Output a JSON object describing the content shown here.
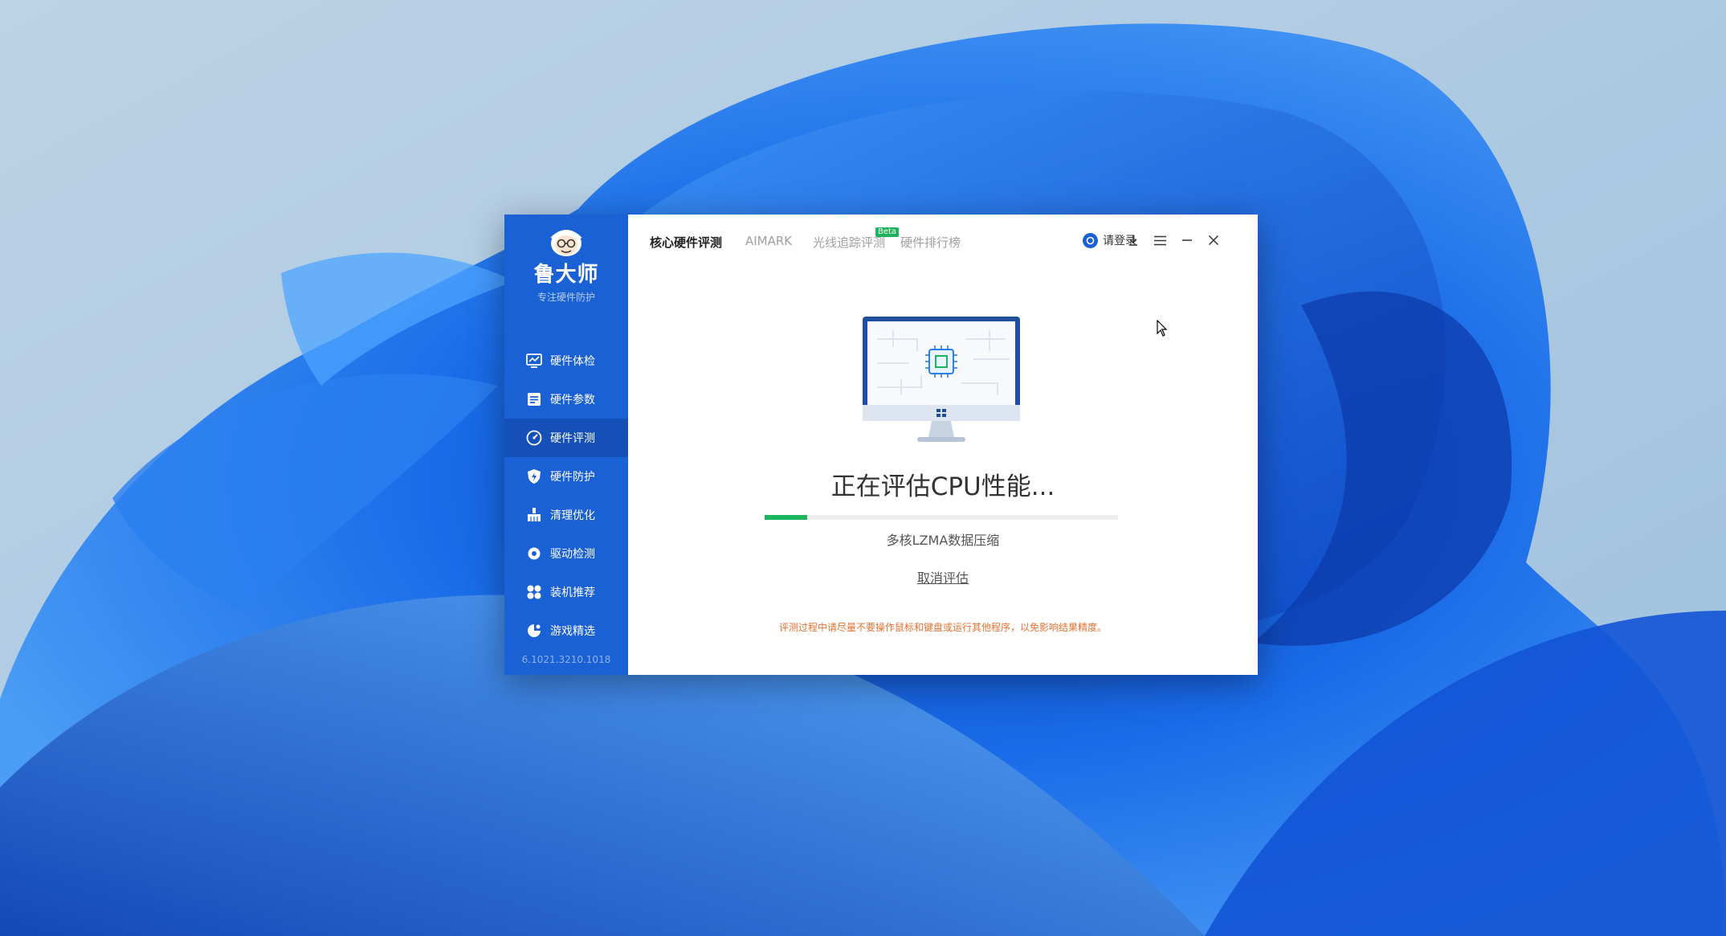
{
  "sidebar": {
    "brand_name": "鲁大师",
    "brand_slogan": "专注硬件防护",
    "items": [
      {
        "label": "硬件体检",
        "icon": "monitor-chart-icon",
        "active": false
      },
      {
        "label": "硬件参数",
        "icon": "list-icon",
        "active": false
      },
      {
        "label": "硬件评测",
        "icon": "speedometer-icon",
        "active": true
      },
      {
        "label": "硬件防护",
        "icon": "shield-bolt-icon",
        "active": false
      },
      {
        "label": "清理优化",
        "icon": "broom-icon",
        "active": false
      },
      {
        "label": "驱动检测",
        "icon": "gear-icon",
        "active": false
      },
      {
        "label": "装机推荐",
        "icon": "grid-icon",
        "active": false
      },
      {
        "label": "游戏精选",
        "icon": "gamepad-icon",
        "active": false
      }
    ],
    "version": "6.1021.3210.1018"
  },
  "header": {
    "tabs": [
      {
        "label": "核心硬件评测",
        "active": true
      },
      {
        "label": "AIMARK",
        "active": false
      },
      {
        "label": "光线追踪评测",
        "active": false
      },
      {
        "label": "硬件排行榜",
        "active": false
      }
    ],
    "beta_badge": "Beta",
    "login_label": "请登录"
  },
  "content": {
    "status_title": "正在评估CPU性能...",
    "progress_fraction": 0.12,
    "progress_step": "多核LZMA数据压缩",
    "cancel_label": "取消评估",
    "warning": "评测过程中请尽量不要操作鼠标和键盘或运行其他程序，以免影响结果精度。"
  },
  "colors": {
    "sidebar": "#1a61d6",
    "sidebar_active": "#1550b8",
    "progress": "#1db45e",
    "warning": "#e8712f"
  }
}
